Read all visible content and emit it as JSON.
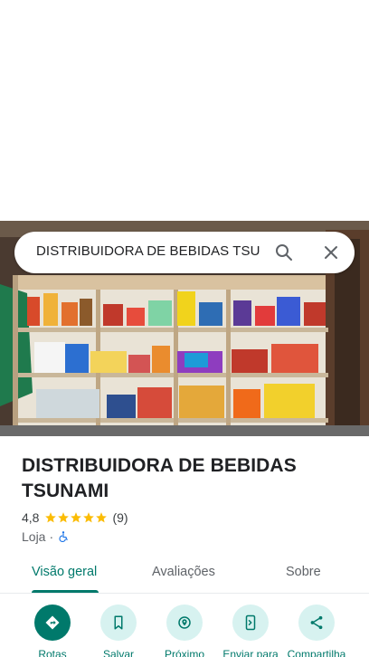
{
  "search": {
    "query": "DISTRIBUIDORA DE BEBIDAS TSUNAMI"
  },
  "place": {
    "name": "DISTRIBUIDORA DE BEBIDAS TSUNAMI",
    "rating": "4,8",
    "rating_stars": 5,
    "review_count": "(9)",
    "category": "Loja",
    "separator": "·",
    "accessibility_icon": "wheelchair-icon"
  },
  "tabs": [
    {
      "label": "Visão geral",
      "active": true
    },
    {
      "label": "Avaliações",
      "active": false
    },
    {
      "label": "Sobre",
      "active": false
    }
  ],
  "actions": [
    {
      "label": "Rotas",
      "icon": "directions-icon"
    },
    {
      "label": "Salvar",
      "icon": "bookmark-icon"
    },
    {
      "label": "Próximo",
      "icon": "nearby-icon"
    },
    {
      "label": "Enviar para",
      "icon": "send-to-phone-icon"
    },
    {
      "label": "Compartilha",
      "icon": "share-icon"
    }
  ],
  "colors": {
    "accent": "#00796b",
    "action_bg": "#d7f2f0",
    "star": "#fbbc04",
    "accessibility_blue": "#1a73e8"
  }
}
